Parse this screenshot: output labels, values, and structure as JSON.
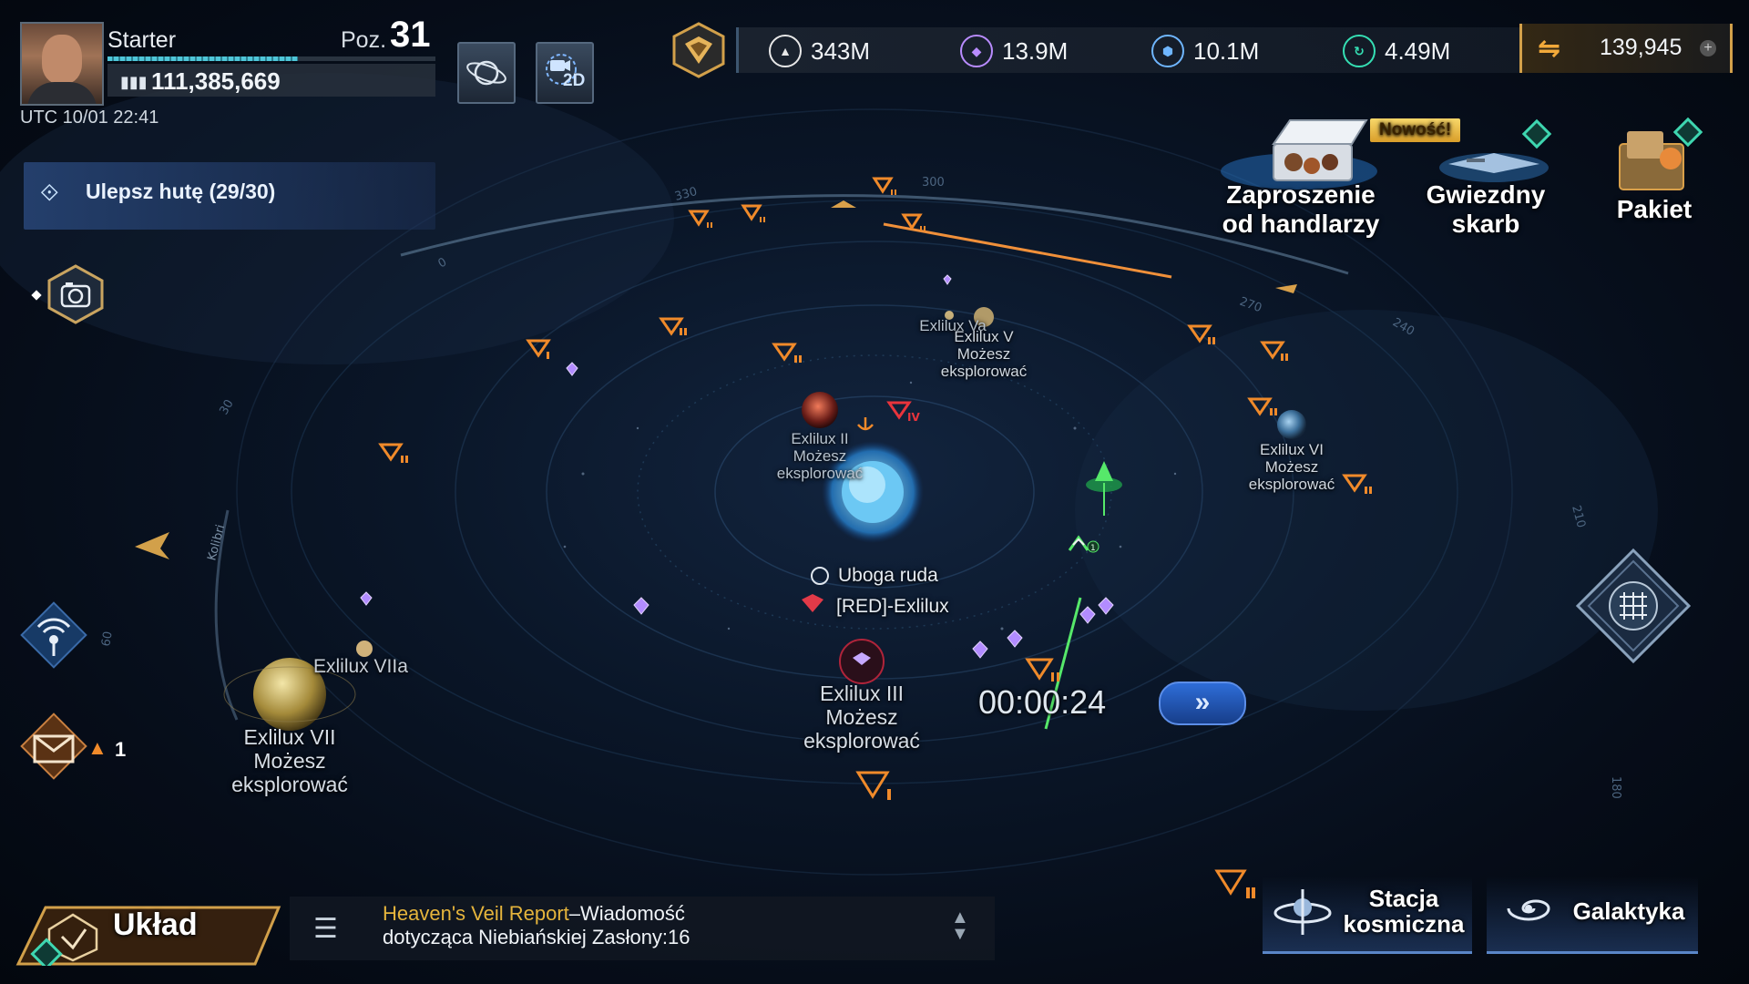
{
  "player": {
    "name": "Starter",
    "level_label": "Poz.",
    "level": "31",
    "power": "111,385,669",
    "utc_time": "UTC  10/01 22:41",
    "xp_progress": 0.58
  },
  "top_buttons": {
    "view_2d_label": "2D"
  },
  "quest": {
    "label": "Ulepsz hutę (29/30)"
  },
  "resources": [
    {
      "icon": "ore-icon",
      "value": "343M",
      "color": "#e8e8e8"
    },
    {
      "icon": "crystal-icon",
      "value": "13.9M",
      "color": "#b98cff"
    },
    {
      "icon": "alloy-icon",
      "value": "10.1M",
      "color": "#6fb6ff"
    },
    {
      "icon": "energy-icon",
      "value": "4.49M",
      "color": "#35e0b4"
    }
  ],
  "currency": {
    "value": "139,945",
    "add": "+"
  },
  "events": {
    "merchant_line1": "Zaproszenie",
    "merchant_line2": "od handlarzy",
    "new_badge": "Nowość!",
    "treasure_line1": "Gwiezdny",
    "treasure_line2": "skarb",
    "pack": "Pakiet"
  },
  "planets": {
    "p2_name": "Exlilux II",
    "p2_status1": "Możesz",
    "p2_status2": "eksplorować",
    "p3_name": "Exlilux III",
    "p3_status1": "Możesz",
    "p3_status2": "eksplorować",
    "p5a_name": "Exlilux Va",
    "p5_name": "Exlilux V",
    "p5_status1": "Możesz",
    "p5_status2": "eksplorować",
    "p6_name": "Exlilux VI",
    "p6_status1": "Możesz",
    "p6_status2": "eksplorować",
    "p7a_name": "Exlilux VIIa",
    "p7_name": "Exlilux VII",
    "p7_status1": "Możesz",
    "p7_status2": "eksplorować"
  },
  "star": {
    "resource": "Uboga ruda",
    "owner": "[RED]-Exlilux"
  },
  "march": {
    "timer": "00:00:24",
    "speed_label": "»",
    "count": "1"
  },
  "mail": {
    "count": "1"
  },
  "bottom": {
    "system_label": "Układ",
    "chat_source": "Heaven's Veil Report",
    "chat_text": "–Wiadomość dotycząca Niebiańskiej Zasłony:16",
    "station_line1": "Stacja",
    "station_line2": "kosmiczna",
    "galaxy_label": "Galaktyka"
  },
  "map": {
    "degree_labels": [
      "330",
      "300",
      "270",
      "240",
      "210",
      "180",
      "0",
      "30",
      "60"
    ],
    "sector_name": "Kolibri"
  },
  "colors": {
    "enemy_marker": "#f08a2a",
    "hostile_marker": "#e8343c",
    "ally_marker": "#38d66a",
    "accent": "#d2a04a"
  }
}
